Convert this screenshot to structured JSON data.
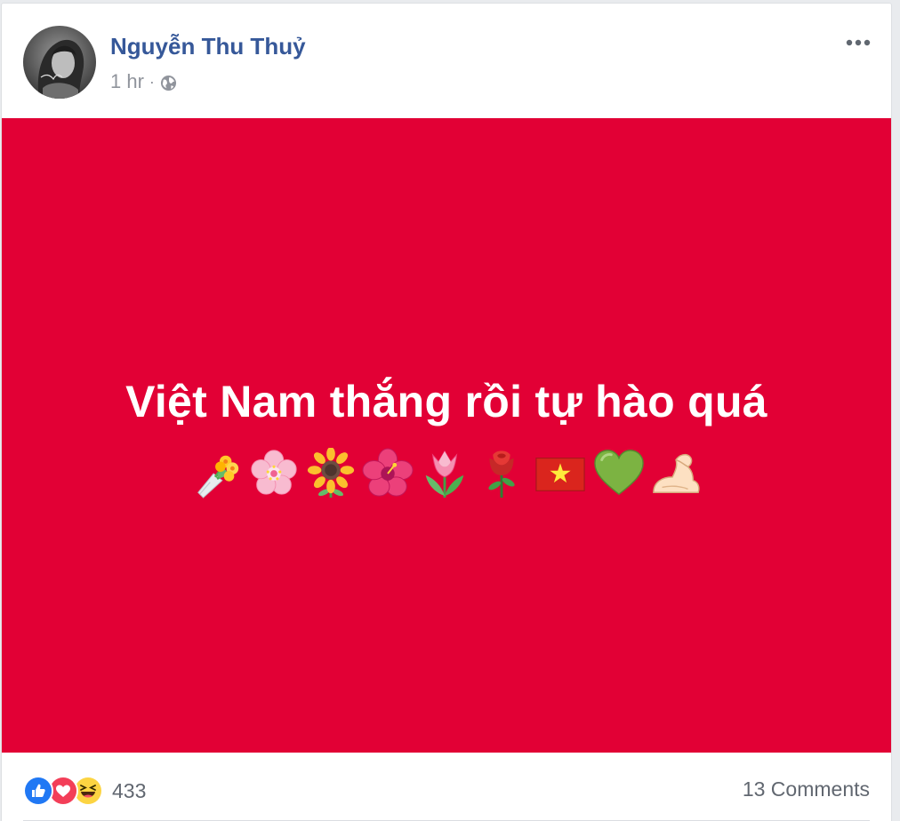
{
  "post": {
    "author": "Nguyễn Thu Thuỷ",
    "timestamp": "1 hr",
    "separator": "·",
    "privacy_icon": "globe-icon",
    "more_icon": "more-options-icon",
    "text": "Việt Nam thắng rồi tự hào quá",
    "emojis": [
      "bouquet",
      "cherry-blossom",
      "sunflower",
      "hibiscus",
      "tulip",
      "rose",
      "vietnam-flag",
      "green-heart",
      "flexed-biceps"
    ],
    "background_color": "#e20035"
  },
  "reactions": {
    "icons": [
      "like-icon",
      "love-icon",
      "haha-icon"
    ],
    "count": "433"
  },
  "comments": {
    "label": "13 Comments"
  },
  "colors": {
    "author_link": "#365899",
    "meta_text": "#90949c",
    "like_blue": "#2078f4",
    "love_red": "#f33e58"
  }
}
